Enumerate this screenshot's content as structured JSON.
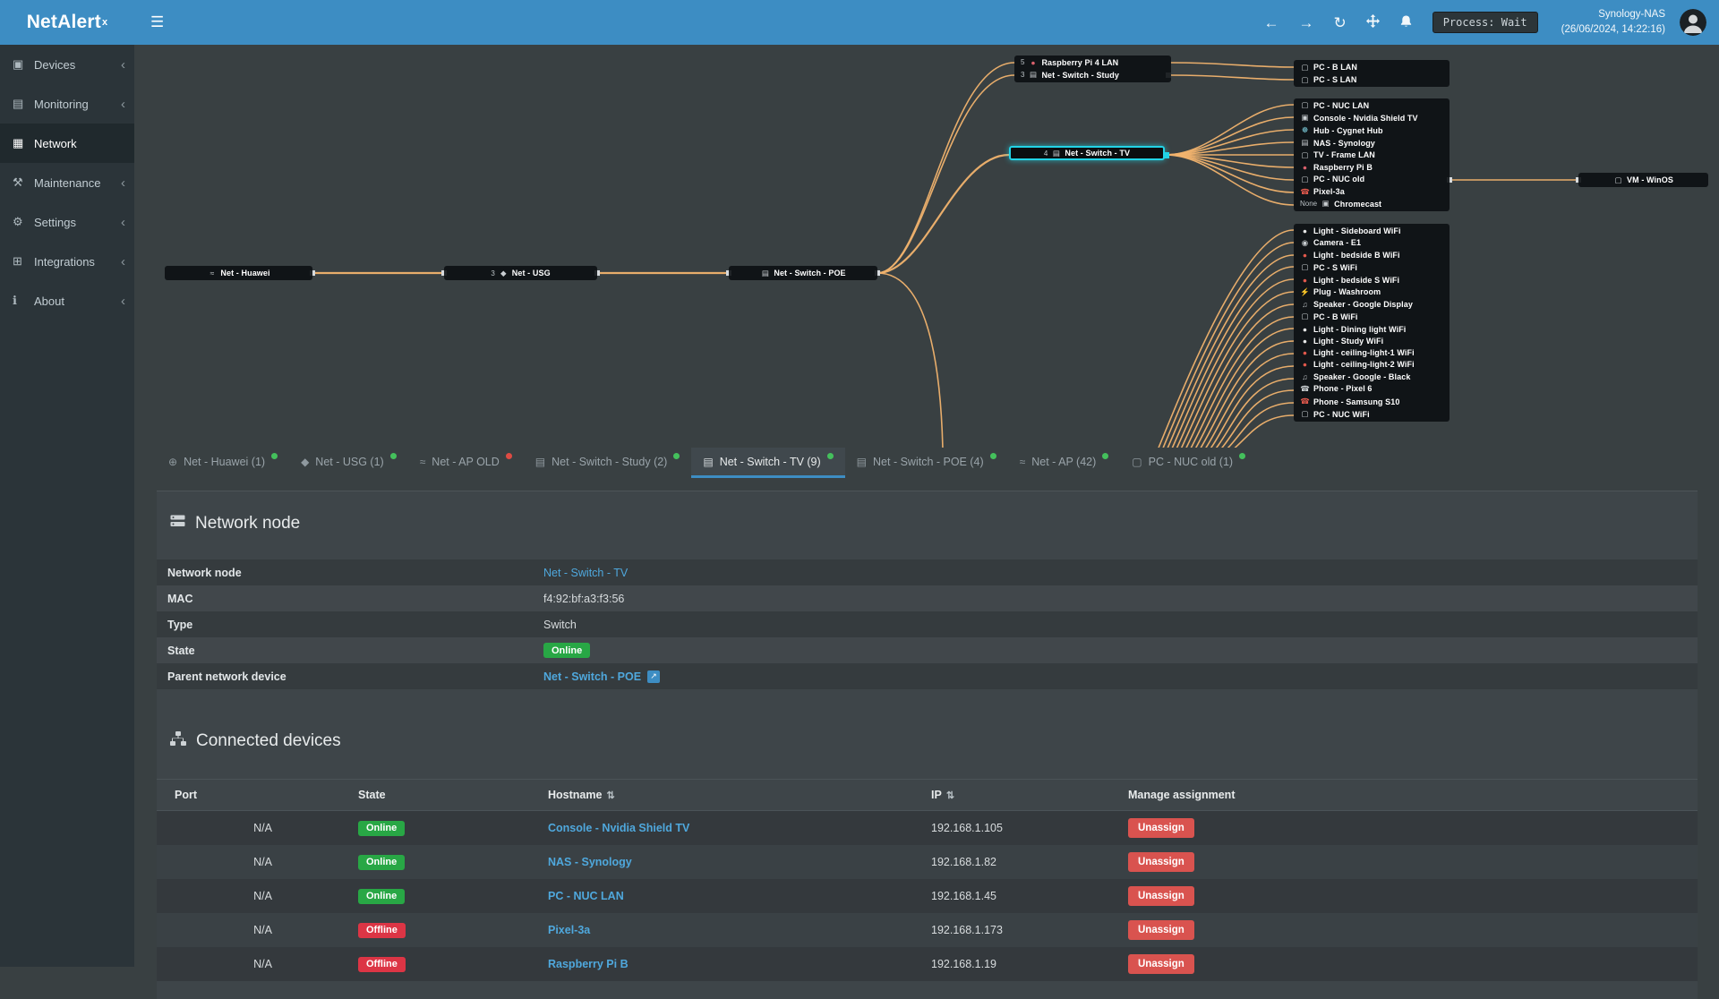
{
  "app": {
    "logo": "NetAlert",
    "logo_sup": "x"
  },
  "topbar": {
    "process_badge": "Process: Wait",
    "host": "Synology-NAS",
    "timestamp": "(26/06/2024, 14:22:16)"
  },
  "sidebar": {
    "items": [
      {
        "name": "sidebar-item-devices",
        "icon": "devices",
        "label": "Devices",
        "chev": "‹"
      },
      {
        "name": "sidebar-item-monitoring",
        "icon": "monitoring",
        "label": "Monitoring",
        "chev": "‹"
      },
      {
        "name": "sidebar-item-network",
        "icon": "network",
        "label": "Network",
        "cls": "active",
        "chev": ""
      },
      {
        "name": "sidebar-item-maintenance",
        "icon": "maintenance",
        "label": "Maintenance",
        "chev": "‹"
      },
      {
        "name": "sidebar-item-settings",
        "icon": "settings",
        "label": "Settings",
        "chev": "‹"
      },
      {
        "name": "sidebar-item-integrations",
        "icon": "integrations",
        "label": "Integrations",
        "chev": "‹"
      },
      {
        "name": "sidebar-item-about",
        "icon": "about",
        "label": "About",
        "chev": "‹"
      }
    ]
  },
  "topology": {
    "huawei": {
      "label": "Net - Huawei"
    },
    "usg": {
      "prefix": "3",
      "label": "Net - USG"
    },
    "poe": {
      "label": "Net - Switch - POE"
    },
    "tv": {
      "prefix": "4",
      "label": "Net - Switch - TV"
    },
    "vm": {
      "label": "VM - WinOS"
    },
    "combo": [
      {
        "prefix": "5",
        "icon": "raspberry",
        "iconColor": "#d9606c",
        "label": "Raspberry Pi 4 LAN"
      },
      {
        "prefix": "3",
        "icon": "switch",
        "label": "Net - Switch - Study"
      }
    ],
    "group_a": [
      {
        "icon": "pc",
        "label": "PC - B LAN"
      },
      {
        "icon": "pc",
        "label": "PC - S LAN"
      }
    ],
    "group_b": [
      {
        "icon": "pc",
        "label": "PC - NUC LAN"
      },
      {
        "icon": "console",
        "label": "Console - Nvidia Shield TV"
      },
      {
        "icon": "hub",
        "label": "Hub - Cygnet Hub",
        "iconColor": "#7fd1e0"
      },
      {
        "icon": "nas",
        "label": "NAS - Synology"
      },
      {
        "icon": "tv",
        "label": "TV - Frame LAN"
      },
      {
        "icon": "raspberry",
        "label": "Raspberry Pi B",
        "iconColor": "#d9606c"
      },
      {
        "icon": "pc",
        "label": "PC - NUC old"
      },
      {
        "icon": "phone",
        "label": "Pixel-3a",
        "iconColor": "#e0584c"
      },
      {
        "prefix": "None",
        "icon": "cast",
        "label": "Chromecast"
      }
    ],
    "group_c": [
      {
        "icon": "bulb",
        "label": "Light - Sideboard WiFi",
        "iconColor": "#e6e6e6"
      },
      {
        "icon": "camera",
        "label": "Camera - E1"
      },
      {
        "icon": "bulb",
        "label": "Light - bedside B WiFi",
        "iconColor": "#e0584c"
      },
      {
        "icon": "pc",
        "label": "PC - S WiFi"
      },
      {
        "icon": "bulb",
        "label": "Light - bedside S WiFi",
        "iconColor": "#e0584c"
      },
      {
        "icon": "plug",
        "label": "Plug - Washroom"
      },
      {
        "icon": "speaker",
        "label": "Speaker - Google Display"
      },
      {
        "icon": "pc",
        "label": "PC - B WiFi"
      },
      {
        "icon": "bulb",
        "label": "Light - Dining light WiFi",
        "iconColor": "#e6e6e6"
      },
      {
        "icon": "bulb",
        "label": "Light - Study WiFi",
        "iconColor": "#e6e6e6"
      },
      {
        "icon": "bulb",
        "label": "Light - ceiling-light-1 WiFi",
        "iconColor": "#e0584c"
      },
      {
        "icon": "bulb",
        "label": "Light - ceiling-light-2 WiFi",
        "iconColor": "#e0584c"
      },
      {
        "icon": "speaker",
        "label": "Speaker - Google - Black"
      },
      {
        "icon": "phone",
        "label": "Phone - Pixel 6"
      },
      {
        "icon": "phone",
        "label": "Phone - Samsung S10",
        "iconColor": "#e0584c"
      },
      {
        "icon": "pc",
        "label": "PC - NUC WiFi"
      }
    ]
  },
  "tabs": [
    {
      "name": "tab-net-huawei",
      "icon": "globe",
      "label": "Net - Huawei (1)",
      "dot": "green"
    },
    {
      "name": "tab-net-usg",
      "icon": "shield",
      "label": "Net - USG (1)",
      "dot": "green"
    },
    {
      "name": "tab-net-ap-old",
      "icon": "wifi",
      "label": "Net - AP OLD",
      "dot": "red"
    },
    {
      "name": "tab-net-switch-study",
      "icon": "switch",
      "label": "Net - Switch - Study (2)",
      "dot": "green"
    },
    {
      "name": "tab-net-switch-tv",
      "icon": "switch",
      "label": "Net - Switch - TV (9)",
      "dot": "green",
      "cls": "active"
    },
    {
      "name": "tab-net-switch-poe",
      "icon": "switch",
      "label": "Net - Switch - POE (4)",
      "dot": "green"
    },
    {
      "name": "tab-net-ap",
      "icon": "wifi",
      "label": "Net - AP (42)",
      "dot": "green"
    },
    {
      "name": "tab-pc-nuc-old",
      "icon": "pc",
      "label": "PC - NUC old (1)",
      "dot": "green"
    }
  ],
  "node_panel": {
    "title": "Network node",
    "rows": {
      "node": {
        "label": "Network node",
        "value": "Net - Switch - TV"
      },
      "mac": {
        "label": "MAC",
        "value": "f4:92:bf:a3:f3:56"
      },
      "type": {
        "label": "Type",
        "value": "Switch"
      },
      "state": {
        "label": "State",
        "value": "Online"
      },
      "parent": {
        "label": "Parent network device",
        "value": "Net - Switch - POE"
      }
    }
  },
  "devices_panel": {
    "title": "Connected devices",
    "columns": {
      "port": "Port",
      "state": "State",
      "hostname": "Hostname",
      "ip": "IP",
      "manage": "Manage assignment"
    },
    "rows": [
      {
        "port": "N/A",
        "state": "Online",
        "stateCls": "online",
        "hostname": "Console - Nvidia Shield TV",
        "ip": "192.168.1.105",
        "action": "Unassign"
      },
      {
        "port": "N/A",
        "state": "Online",
        "stateCls": "online",
        "hostname": "NAS - Synology",
        "ip": "192.168.1.82",
        "action": "Unassign"
      },
      {
        "port": "N/A",
        "state": "Online",
        "stateCls": "online",
        "hostname": "PC - NUC LAN",
        "ip": "192.168.1.45",
        "action": "Unassign"
      },
      {
        "port": "N/A",
        "state": "Offline",
        "stateCls": "offline",
        "hostname": "Pixel-3a",
        "ip": "192.168.1.173",
        "action": "Unassign"
      },
      {
        "port": "N/A",
        "state": "Offline",
        "stateCls": "offline",
        "hostname": "Raspberry Pi B",
        "ip": "192.168.1.19",
        "action": "Unassign"
      }
    ]
  },
  "colors": {
    "accent": "#3d8dc3",
    "edge": "#f1b36e",
    "online": "#28a745",
    "offline": "#dc3545",
    "highlight": "#22d3e6"
  }
}
